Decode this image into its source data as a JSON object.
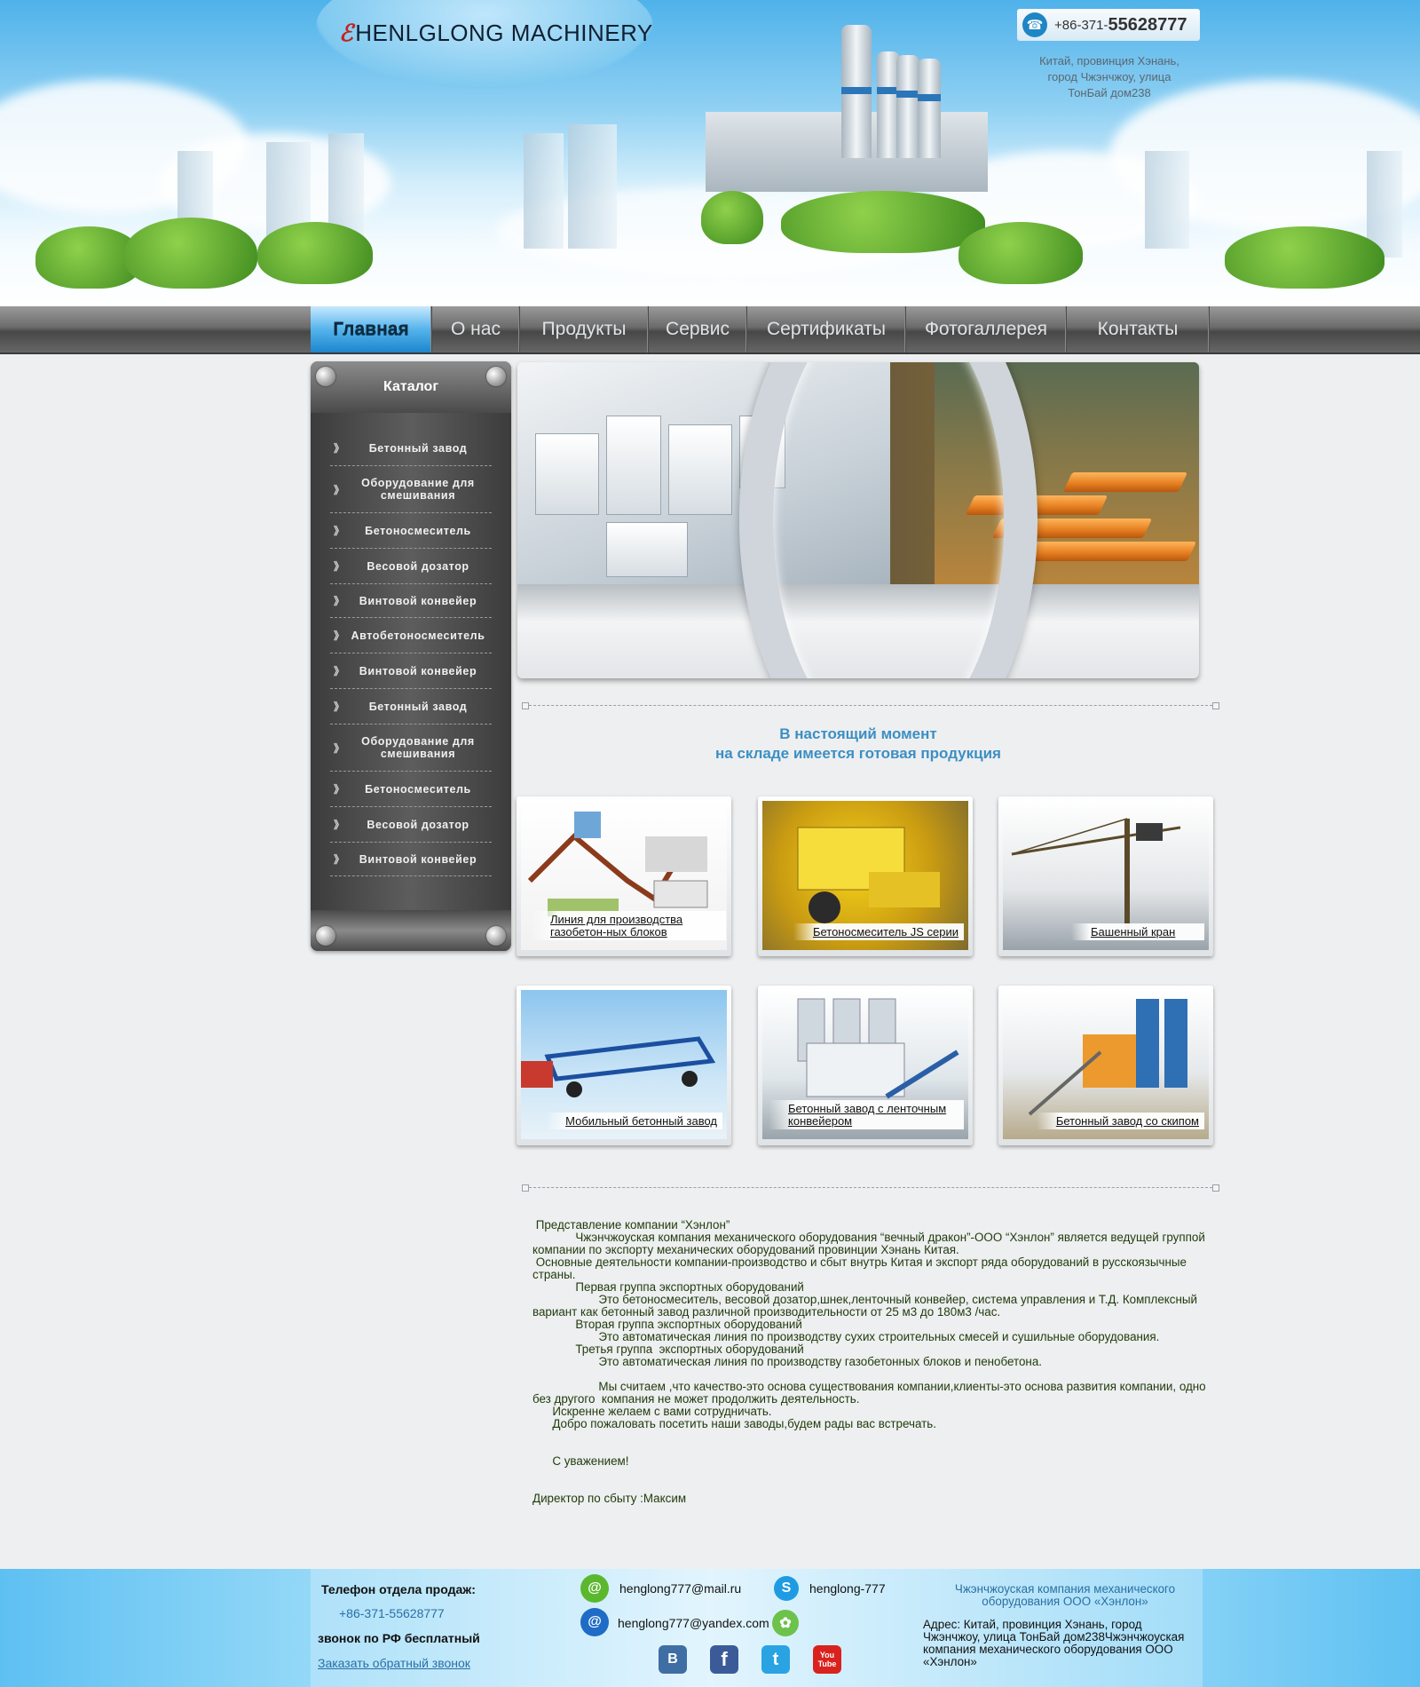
{
  "header": {
    "logo_text": "HENLGLONG MACHINERY",
    "phone_prefix": "+86-371-",
    "phone_main": "55628777",
    "address_lines": [
      "Китай, провинция Хэнань,",
      "город Чжэнчжоу, улица",
      "ТонБай дом238"
    ]
  },
  "nav": {
    "items": [
      "Главная",
      "О нас",
      "Продукты",
      "Сервис",
      "Сертификаты",
      "Фотогаллерея",
      "Контакты"
    ],
    "active_index": 0
  },
  "sidebar": {
    "title": "Каталог",
    "items": [
      "Бетонный завод",
      "Оборудование для смешивания",
      "Бетоносмеситель",
      "Весовой дозатор",
      "Винтовой конвейер",
      "Автобетоносмеситель",
      "Винтовой конвейер",
      "Бетонный завод",
      "Оборудование для смешивания",
      "Бетоносмеситель",
      "Весовой дозатор",
      "Винтовой конвейер"
    ]
  },
  "stock": {
    "heading_line1": "В настоящий момент",
    "heading_line2": "на складе имеется готовая продукция"
  },
  "products": [
    {
      "caption": "Линия для производства газобетон-ных блоков"
    },
    {
      "caption": "Бетоносмеситель JS серии"
    },
    {
      "caption": "Башенный кран"
    },
    {
      "caption": "Мобильный бетонный завод"
    },
    {
      "caption": "Бетонный завод с ленточным конвейером"
    },
    {
      "caption": "Бетонный завод со скипом"
    }
  ],
  "about": {
    "paragraphs": [
      " Представление компании “Хэнлон”",
      "             Чжэнчжоуская компания механического оборудования “вечный дракон”-ООО “Хэнлон” является ведущей группой компании по экспорту механических оборудований провинции Хэнань Китая.",
      " Основные деятельности компании-производство и сбыт внутрь Китая и экспорт ряда оборудований в русскоязычные страны.",
      "             Первая группа экспортных оборудований",
      "                    Это бетоносмеситель, весовой дозатор,шнек,ленточный конвейер, система управления и Т.Д. Комплексный вариант как бетонный завод различной производительности от 25 м3 до 180м3 /час.",
      "             Вторая группа экспортных оборудований",
      "                    Это автоматическая линия по производству сухих строительных смесей и сушильные оборудования.",
      "             Третья группа  экспортных оборудований",
      "                    Это автоматическая линия по производству газобетонных блоков и пенобетона.",
      "",
      "                    Мы считаем ,что качество-это основа существования компании,клиенты-это основа развития компании, одно без другого  компания не может продолжить деятельность.",
      "      Искренне желаем с вами сотрудничать.",
      "      Добро пожаловать посетить наши заводы,будем рады вас встречать.",
      "",
      "",
      "      С уважением!",
      "",
      "",
      "Директор по сбыту :Максим"
    ]
  },
  "footer": {
    "sales_phone_label": "Телефон отдела продаж:",
    "sales_phone": "+86-371-55628777",
    "free_call": "звонок по РФ бесплатный",
    "callback_link": "Заказать обратный звонок",
    "email_mail": "henglong777@mail.ru",
    "email_yandex": "henglong777@yandex.com",
    "skype": "henglong-777",
    "company_name": "Чжэнчжоуская компания механического оборудования ООО «Хэнлон»",
    "address": "Адрес: Китай, провинция Хэнань, город Чжэнчжоу, улица ТонБай дом238Чжэнчжоуская компания механического оборудования ООО «Хэнлон»",
    "social": [
      "В",
      "f",
      "t",
      "You Tube"
    ]
  },
  "colors": {
    "accent_blue": "#3b8fc4",
    "nav_active": "#1c86cc",
    "text_green": "#1f3a0c"
  }
}
